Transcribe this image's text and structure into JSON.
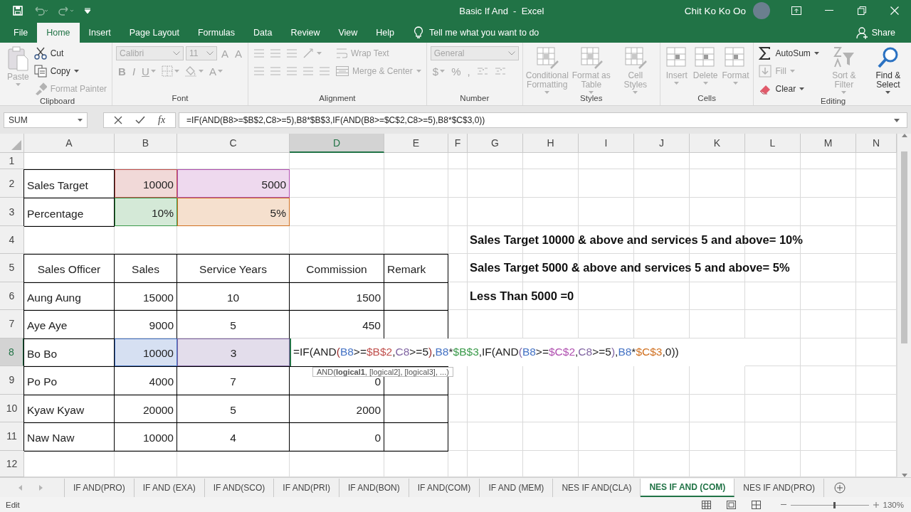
{
  "window": {
    "title": "Basic If And  -  Excel",
    "user": "Chit Ko Ko Oo"
  },
  "ribbon_tabs": [
    {
      "label": "File",
      "selected": false
    },
    {
      "label": "Home",
      "selected": true
    },
    {
      "label": "Insert",
      "selected": false
    },
    {
      "label": "Page Layout",
      "selected": false
    },
    {
      "label": "Formulas",
      "selected": false
    },
    {
      "label": "Data",
      "selected": false
    },
    {
      "label": "Review",
      "selected": false
    },
    {
      "label": "View",
      "selected": false
    },
    {
      "label": "Help",
      "selected": false
    }
  ],
  "tell_me": {
    "placeholder": "Tell me what you want to do"
  },
  "share": "Share",
  "ribbon_groups": [
    {
      "name": "Clipboard",
      "columns": [
        [
          [
            {
              "kind": "large",
              "label": "Paste",
              "disabled": true,
              "dropdown": true
            }
          ]
        ],
        [
          [
            {
              "kind": "small",
              "label": "Cut",
              "disabled": false
            }
          ],
          [
            {
              "kind": "small",
              "label": "Copy",
              "disabled": false,
              "dropdown": true
            }
          ],
          [
            {
              "kind": "small",
              "label": "Format Painter",
              "disabled": true
            }
          ]
        ]
      ]
    },
    {
      "name": "Font",
      "columns": [
        [
          [
            {
              "kind": "field",
              "value": "Calibri",
              "disabled": true
            },
            {
              "kind": "field",
              "value": "11",
              "disabled": true
            },
            {
              "kind": "glyph",
              "label": "A",
              "disabled": true
            },
            {
              "kind": "glyph",
              "label": "A",
              "disabled": true
            }
          ],
          [
            {
              "kind": "bold",
              "label": "B",
              "disabled": true
            },
            {
              "kind": "italic",
              "label": "I",
              "disabled": true
            },
            {
              "kind": "underline",
              "label": "U",
              "disabled": true,
              "dropdown": true
            },
            {
              "kind": "icon",
              "disabled": true,
              "dropdown": true
            },
            {
              "kind": "icon",
              "disabled": true,
              "dropdown": true
            },
            {
              "kind": "glyph",
              "label": "A",
              "disabled": true,
              "dropdown": true
            }
          ]
        ]
      ]
    },
    {
      "name": "Alignment",
      "columns": [
        [
          [
            {
              "kind": "icon",
              "disabled": true
            },
            {
              "kind": "icon",
              "disabled": true
            },
            {
              "kind": "icon",
              "disabled": true
            },
            {
              "kind": "icon",
              "disabled": true,
              "dropdown": true
            }
          ],
          [
            {
              "kind": "icon",
              "disabled": true
            },
            {
              "kind": "icon",
              "disabled": true
            },
            {
              "kind": "icon",
              "disabled": true
            },
            {
              "kind": "icon",
              "disabled": true
            },
            {
              "kind": "icon",
              "disabled": true
            }
          ]
        ],
        [
          [
            {
              "kind": "small",
              "label": "Wrap Text",
              "disabled": true
            }
          ],
          [
            {
              "kind": "small",
              "label": "Merge & Center",
              "disabled": true,
              "dropdown": true
            }
          ]
        ]
      ]
    },
    {
      "name": "Number",
      "columns": [
        [
          [
            {
              "kind": "field",
              "value": "General",
              "disabled": true
            }
          ],
          [
            {
              "kind": "glyph",
              "label": "$",
              "disabled": true,
              "dropdown": true
            },
            {
              "kind": "glyph",
              "label": "%",
              "disabled": true
            },
            {
              "kind": "glyph",
              "label": ",",
              "disabled": true
            },
            {
              "kind": "icon",
              "disabled": true
            },
            {
              "kind": "icon",
              "disabled": true
            }
          ]
        ]
      ]
    },
    {
      "name": "Styles",
      "columns": [
        [
          [
            {
              "kind": "large",
              "label": "Conditional Formatting",
              "disabled": true,
              "dropdown": true
            }
          ]
        ],
        [
          [
            {
              "kind": "large",
              "label": "Format as Table",
              "disabled": true,
              "dropdown": true
            }
          ]
        ],
        [
          [
            {
              "kind": "large",
              "label": "Cell Styles",
              "disabled": true,
              "dropdown": true
            }
          ]
        ]
      ]
    },
    {
      "name": "Cells",
      "columns": [
        [
          [
            {
              "kind": "large",
              "label": "Insert",
              "disabled": true,
              "dropdown": true
            }
          ]
        ],
        [
          [
            {
              "kind": "large",
              "label": "Delete",
              "disabled": true,
              "dropdown": true
            }
          ]
        ],
        [
          [
            {
              "kind": "large",
              "label": "Format",
              "disabled": true,
              "dropdown": true
            }
          ]
        ]
      ]
    },
    {
      "name": "Editing",
      "columns": [
        [
          [
            {
              "kind": "small",
              "label": "AutoSum",
              "disabled": false,
              "dropdown": true
            }
          ],
          [
            {
              "kind": "small",
              "label": "Fill",
              "disabled": true,
              "dropdown": true
            }
          ],
          [
            {
              "kind": "small",
              "label": "Clear",
              "disabled": false,
              "dropdown": true
            }
          ]
        ],
        [
          [
            {
              "kind": "large",
              "label": "Sort & Filter",
              "disabled": true,
              "dropdown": true
            }
          ]
        ],
        [
          [
            {
              "kind": "large",
              "label": "Find & Select",
              "disabled": false,
              "dropdown": true
            }
          ]
        ]
      ]
    }
  ],
  "formula_bar": {
    "name_box": "SUM",
    "function_button": "fx",
    "formula": "=IF(AND(B8>=$B$2,C8>=5),B8*$B$3,IF(AND(B8>=$C$2,C8>=5),B8*$C$3,0))"
  },
  "sheet": {
    "columns": [
      {
        "label": "A",
        "selected": false
      },
      {
        "label": "B",
        "selected": false
      },
      {
        "label": "C",
        "selected": false
      },
      {
        "label": "D",
        "selected": true
      },
      {
        "label": "E",
        "selected": false
      },
      {
        "label": "F",
        "selected": false
      },
      {
        "label": "G",
        "selected": false
      },
      {
        "label": "H",
        "selected": false
      },
      {
        "label": "I",
        "selected": false
      },
      {
        "label": "J",
        "selected": false
      },
      {
        "label": "K",
        "selected": false
      },
      {
        "label": "L",
        "selected": false
      },
      {
        "label": "M",
        "selected": false
      },
      {
        "label": "N",
        "selected": false
      }
    ],
    "rows": [
      {
        "label": "1",
        "selected": false
      },
      {
        "label": "2",
        "selected": false,
        "cells": [
          {
            "kind": "label",
            "text": "Sales Target"
          },
          {
            "kind": "number",
            "text": "10000",
            "color": "#c0504d"
          },
          {
            "kind": "number",
            "text": "5000",
            "color": "#b050b0"
          }
        ]
      },
      {
        "label": "3",
        "selected": false,
        "cells": [
          {
            "kind": "label",
            "text": "Percentage"
          },
          {
            "kind": "number",
            "text": "10%",
            "color": "#3a9a4a"
          },
          {
            "kind": "number",
            "text": "5%",
            "color": "#d07020"
          }
        ]
      },
      {
        "label": "4",
        "selected": false
      },
      {
        "label": "5",
        "selected": false,
        "cells": [
          {
            "kind": "header",
            "text": "Sales Officer"
          },
          {
            "kind": "header",
            "text": "Sales"
          },
          {
            "kind": "header",
            "text": "Service Years"
          },
          {
            "kind": "header",
            "text": "Commission"
          },
          {
            "kind": "label",
            "text": "Remark"
          }
        ]
      },
      {
        "label": "6",
        "selected": false,
        "cells": [
          {
            "kind": "label",
            "text": "Aung Aung"
          },
          {
            "kind": "number",
            "text": "15000"
          },
          {
            "kind": "center",
            "text": "10"
          },
          {
            "kind": "number",
            "text": "1500"
          },
          {
            "kind": "blank"
          }
        ]
      },
      {
        "label": "7",
        "selected": false,
        "cells": [
          {
            "kind": "label",
            "text": "Aye Aye"
          },
          {
            "kind": "number",
            "text": "9000"
          },
          {
            "kind": "center",
            "text": "5"
          },
          {
            "kind": "number",
            "text": "450"
          },
          {
            "kind": "blank"
          }
        ]
      },
      {
        "label": "8",
        "selected": true,
        "cells": [
          {
            "kind": "label",
            "text": "Bo Bo"
          },
          {
            "kind": "number",
            "text": "10000",
            "color": "#4472c4"
          },
          {
            "kind": "center",
            "text": "3",
            "color": "#8064a2"
          }
        ]
      },
      {
        "label": "9",
        "selected": false,
        "cells": [
          {
            "kind": "label",
            "text": "Po Po"
          },
          {
            "kind": "number",
            "text": "4000"
          },
          {
            "kind": "center",
            "text": "7"
          },
          {
            "kind": "number",
            "text": "0"
          },
          {
            "kind": "blank"
          }
        ]
      },
      {
        "label": "10",
        "selected": false,
        "cells": [
          {
            "kind": "label",
            "text": "Kyaw Kyaw"
          },
          {
            "kind": "number",
            "text": "20000"
          },
          {
            "kind": "center",
            "text": "5"
          },
          {
            "kind": "number",
            "text": "2000"
          },
          {
            "kind": "blank"
          }
        ]
      },
      {
        "label": "11",
        "selected": false,
        "cells": [
          {
            "kind": "label",
            "text": "Naw Naw"
          },
          {
            "kind": "number",
            "text": "10000"
          },
          {
            "kind": "center",
            "text": "4"
          },
          {
            "kind": "number",
            "text": "0"
          },
          {
            "kind": "blank"
          }
        ]
      },
      {
        "label": "12",
        "selected": false
      }
    ],
    "notes": [
      "Sales Target 10000 & above and services 5 and above= 10%",
      "Sales Target 5000 & above and services 5 and above= 5%",
      "Less Than 5000 =0"
    ],
    "editor": {
      "segments": [
        {
          "text": "=IF(AND"
        },
        {
          "text": "(",
          "color": "#a03030"
        },
        {
          "text": "B8",
          "color": "#4472c4"
        },
        {
          "text": ">="
        },
        {
          "text": "$B$2",
          "color": "#c0504d"
        },
        {
          "text": ","
        },
        {
          "text": "C8",
          "color": "#8064a2"
        },
        {
          "text": ">=5"
        },
        {
          "text": ")",
          "color": "#a03030"
        },
        {
          "text": ","
        },
        {
          "text": "B8",
          "color": "#4472c4"
        },
        {
          "text": "*"
        },
        {
          "text": "$B$3",
          "color": "#3a9a4a"
        },
        {
          "text": ",IF(AND"
        },
        {
          "text": "(",
          "color": "#8064a2"
        },
        {
          "text": "B8",
          "color": "#4472c4"
        },
        {
          "text": ">="
        },
        {
          "text": "$C$2",
          "color": "#b050b0"
        },
        {
          "text": ","
        },
        {
          "text": "C8",
          "color": "#8064a2"
        },
        {
          "text": ">=5"
        },
        {
          "text": ")",
          "color": "#8064a2"
        },
        {
          "text": ","
        },
        {
          "text": "B8",
          "color": "#4472c4"
        },
        {
          "text": "*"
        },
        {
          "text": "$C$3",
          "color": "#d07020"
        },
        {
          "text": ",0))"
        }
      ],
      "tooltip": "AND(**logical1**, [logical2], [logical3], ...)"
    }
  },
  "sheet_tabs": [
    {
      "label": "IF AND(PRO)",
      "selected": false
    },
    {
      "label": "IF AND (EXA)",
      "selected": false
    },
    {
      "label": "IF AND(SCO)",
      "selected": false
    },
    {
      "label": "IF AND(PRI)",
      "selected": false
    },
    {
      "label": "IF AND(BON)",
      "selected": false
    },
    {
      "label": "IF AND(COM)",
      "selected": false
    },
    {
      "label": "IF AND (MEM)",
      "selected": false
    },
    {
      "label": "NES IF AND(CLA)",
      "selected": false
    },
    {
      "label": "NES IF AND (COM)",
      "selected": true
    },
    {
      "label": "NES IF AND(PRO)",
      "selected": false
    }
  ],
  "status_bar": {
    "mode": "Edit",
    "zoom": {
      "level": 0.55,
      "reading": "130%"
    }
  }
}
